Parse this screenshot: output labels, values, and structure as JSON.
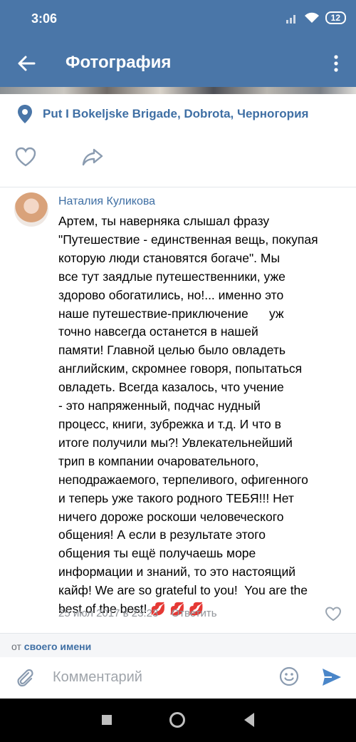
{
  "status_bar": {
    "time": "3:06",
    "battery": "12"
  },
  "header": {
    "title": "Фотография"
  },
  "location": {
    "text": "Put I Bokeljske Brigade, Dobrota, Черногория"
  },
  "comment": {
    "author": "Наталия Куликова",
    "text": "Артем, ты наверняка слышал фразу\n\"Путешествие - единственная вещь, покупая\nкоторую люди становятся богаче\". Мы\nвсе тут заядлые путешественники, уже\nздорово обогатились, но!... именно это\nнаше путешествие-приключение      уж\nточно навсегда останется в нашей\nпамяти! Главной целью было овладеть\nанглийским, скромнее говоря, попытаться\nовладеть. Всегда казалось, что учение\n- это напряженный, подчас нудный\nпроцесс, книги, зубрежка и т.д. И что в\nитоге получили мы?! Увлекательнейший\nтрип в компании очаровательного,\nнеподражаемого, терпеливого, офигенного\nи теперь уже такого родного ТЕБЯ!!! Нет\nничего дороже роскоши человеческого\nобщения! А если в результате этого\nобщения ты ещё получаешь море\nинформации и знаний, то это настоящий\nкайф! We are so grateful to you!  You are the\nbest of the best! 💋 💋 💋",
    "date": "25 июл 2017 в 23:23",
    "reply_label": "Ответить"
  },
  "posting_as": {
    "prefix": "от",
    "link": "своего имени"
  },
  "compose": {
    "placeholder": "Комментарий"
  },
  "colors": {
    "brand": "#4a76a8",
    "link": "#3f6fa4"
  }
}
